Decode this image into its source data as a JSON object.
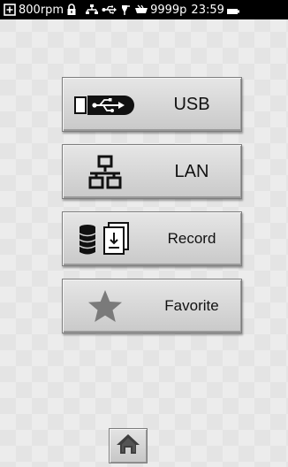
{
  "status_bar": {
    "rpm": "800rpm",
    "pages": "9999p",
    "time": "23:59"
  },
  "menu": {
    "usb_label": "USB",
    "lan_label": "LAN",
    "record_label": "Record",
    "favorite_label": "Favorite"
  },
  "icons": {
    "status": [
      "plus-box-icon",
      "lock-icon",
      "network-icon",
      "usb-icon",
      "pen-icon",
      "paper-tray-icon",
      "battery-icon"
    ],
    "menu": [
      "usb-icon",
      "lan-icon",
      "record-icon",
      "star-icon"
    ],
    "nav": [
      "home-icon"
    ]
  }
}
